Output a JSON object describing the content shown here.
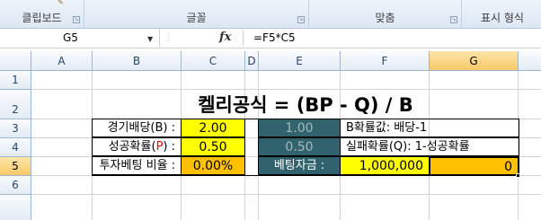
{
  "ribbon": {
    "groups": [
      {
        "label": "클립보드"
      },
      {
        "label": "글꼴"
      },
      {
        "label": "맞춤"
      },
      {
        "label": "표시 형식"
      }
    ]
  },
  "formula_bar": {
    "name_box": "G5",
    "fx": "fx",
    "formula": "=F5*C5"
  },
  "columns": [
    "A",
    "B",
    "C",
    "D",
    "E",
    "F",
    "G"
  ],
  "rows": [
    "1",
    "2",
    "3",
    "4",
    "5",
    "6"
  ],
  "sheet": {
    "title": "켈리공식 = (BP - Q) / B",
    "b3": "경기배당(B) :",
    "c3": "2.00",
    "e3": "1.00",
    "f3": "B확률값: 배당-1",
    "b4_pre": "성공확률(",
    "b4_p": "P",
    "b4_post": ") :",
    "c4": "0.50",
    "e4": "0.50",
    "f4": "실패확률(Q): 1-성공확률",
    "b5": "투자베팅 비율 :",
    "c5": "0.00%",
    "e5": "베팅자금 :",
    "f5": "1,000,000",
    "g5": "0"
  },
  "colors": {
    "yellow": "#ffff00",
    "orange": "#ffc000",
    "teal": "#31636e"
  }
}
